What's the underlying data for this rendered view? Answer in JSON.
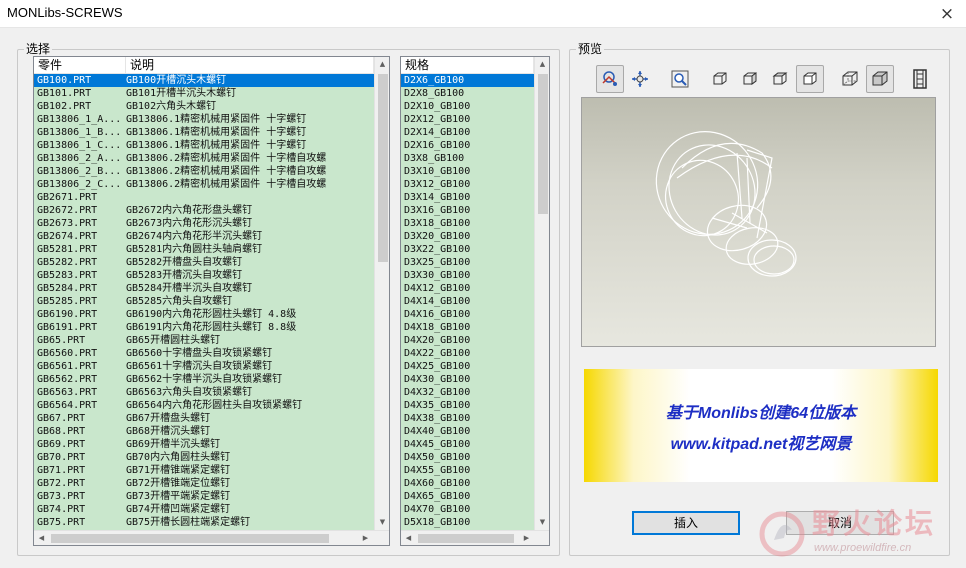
{
  "window": {
    "title": "MONLibs-SCREWS",
    "close_icon": "×"
  },
  "select_group": {
    "label": "选择",
    "columns": {
      "part": "零件",
      "desc": "说明"
    },
    "rows": [
      {
        "part": "GB100.PRT",
        "desc": "GB100开槽沉头木螺钉",
        "selected": true
      },
      {
        "part": "GB101.PRT",
        "desc": "GB101开槽半沉头木螺钉"
      },
      {
        "part": "GB102.PRT",
        "desc": "GB102六角头木螺钉"
      },
      {
        "part": "GB13806_1_A...",
        "desc": "GB13806.1精密机械用紧固件     十字螺钉"
      },
      {
        "part": "GB13806_1_B...",
        "desc": "GB13806.1精密机械用紧固件     十字螺钉"
      },
      {
        "part": "GB13806_1_C...",
        "desc": "GB13806.1精密机械用紧固件     十字螺钉"
      },
      {
        "part": "GB13806_2_A...",
        "desc": "GB13806.2精密机械用紧固件    十字槽自攻螺"
      },
      {
        "part": "GB13806_2_B...",
        "desc": "GB13806.2精密机械用紧固件    十字槽自攻螺"
      },
      {
        "part": "GB13806_2_C...",
        "desc": "GB13806.2精密机械用紧固件    十字槽自攻螺"
      },
      {
        "part": "GB2671.PRT",
        "desc": ""
      },
      {
        "part": "GB2672.PRT",
        "desc": "GB2672内六角花形盘头螺钉"
      },
      {
        "part": "GB2673.PRT",
        "desc": "GB2673内六角花形沉头螺钉"
      },
      {
        "part": "GB2674.PRT",
        "desc": "GB2674内六角花形半沉头螺钉"
      },
      {
        "part": "GB5281.PRT",
        "desc": "GB5281内六角圆柱头轴肩螺钉"
      },
      {
        "part": "GB5282.PRT",
        "desc": "GB5282开槽盘头自攻螺钉"
      },
      {
        "part": "GB5283.PRT",
        "desc": "GB5283开槽沉头自攻螺钉"
      },
      {
        "part": "GB5284.PRT",
        "desc": "GB5284开槽半沉头自攻螺钉"
      },
      {
        "part": "GB5285.PRT",
        "desc": "GB5285六角头自攻螺钉"
      },
      {
        "part": "GB6190.PRT",
        "desc": "GB6190内六角花形圆柱头螺钉   4.8级"
      },
      {
        "part": "GB6191.PRT",
        "desc": "GB6191内六角花形圆柱头螺钉   8.8级"
      },
      {
        "part": "GB65.PRT",
        "desc": "GB65开槽圆柱头螺钉"
      },
      {
        "part": "GB6560.PRT",
        "desc": "GB6560十字槽盘头自攻锁紧螺钉"
      },
      {
        "part": "GB6561.PRT",
        "desc": "GB6561十字槽沉头自攻锁紧螺钉"
      },
      {
        "part": "GB6562.PRT",
        "desc": "GB6562十字槽半沉头自攻锁紧螺钉"
      },
      {
        "part": "GB6563.PRT",
        "desc": "GB6563六角头自攻锁紧螺钉"
      },
      {
        "part": "GB6564.PRT",
        "desc": "GB6564内六角花形圆柱头自攻锁紧螺钉"
      },
      {
        "part": "GB67.PRT",
        "desc": "GB67开槽盘头螺钉"
      },
      {
        "part": "GB68.PRT",
        "desc": "GB68开槽沉头螺钉"
      },
      {
        "part": "GB69.PRT",
        "desc": "GB69开槽半沉头螺钉"
      },
      {
        "part": "GB70.PRT",
        "desc": "GB70内六角圆柱头螺钉"
      },
      {
        "part": "GB71.PRT",
        "desc": "GB71开槽锥端紧定螺钉"
      },
      {
        "part": "GB72.PRT",
        "desc": "GB72开槽锥端定位螺钉"
      },
      {
        "part": "GB73.PRT",
        "desc": "GB73开槽平端紧定螺钉"
      },
      {
        "part": "GB74.PRT",
        "desc": "GB74开槽凹端紧定螺钉"
      },
      {
        "part": "GB75.PRT",
        "desc": "GB75开槽长圆柱端紧定螺钉"
      }
    ]
  },
  "spec_list": {
    "column": "规格",
    "rows": [
      {
        "spec": "D2X6_GB100",
        "selected": true
      },
      {
        "spec": "D2X8_GB100"
      },
      {
        "spec": "D2X10_GB100"
      },
      {
        "spec": "D2X12_GB100"
      },
      {
        "spec": "D2X14_GB100"
      },
      {
        "spec": "D2X16_GB100"
      },
      {
        "spec": "D3X8_GB100"
      },
      {
        "spec": "D3X10_GB100"
      },
      {
        "spec": "D3X12_GB100"
      },
      {
        "spec": "D3X14_GB100"
      },
      {
        "spec": "D3X16_GB100"
      },
      {
        "spec": "D3X18_GB100"
      },
      {
        "spec": "D3X20_GB100"
      },
      {
        "spec": "D3X22_GB100"
      },
      {
        "spec": "D3X25_GB100"
      },
      {
        "spec": "D3X30_GB100"
      },
      {
        "spec": "D4X12_GB100"
      },
      {
        "spec": "D4X14_GB100"
      },
      {
        "spec": "D4X16_GB100"
      },
      {
        "spec": "D4X18_GB100"
      },
      {
        "spec": "D4X20_GB100"
      },
      {
        "spec": "D4X22_GB100"
      },
      {
        "spec": "D4X25_GB100"
      },
      {
        "spec": "D4X30_GB100"
      },
      {
        "spec": "D4X32_GB100"
      },
      {
        "spec": "D4X35_GB100"
      },
      {
        "spec": "D4X38_GB100"
      },
      {
        "spec": "D4X40_GB100"
      },
      {
        "spec": "D4X45_GB100"
      },
      {
        "spec": "D4X50_GB100"
      },
      {
        "spec": "D4X55_GB100"
      },
      {
        "spec": "D4X60_GB100"
      },
      {
        "spec": "D4X65_GB100"
      },
      {
        "spec": "D4X70_GB100"
      },
      {
        "spec": "D5X18_GB100"
      }
    ]
  },
  "preview_group": {
    "label": "预览",
    "toolbar": [
      {
        "icon": "spin-rotate-icon",
        "pressed": true
      },
      {
        "icon": "pan-icon",
        "pressed": false
      },
      {
        "icon": "zoom-window-icon",
        "pressed": false
      },
      {
        "icon": "view-front-icon",
        "pressed": false
      },
      {
        "icon": "view-side-icon",
        "pressed": false
      },
      {
        "icon": "view-top-icon",
        "pressed": false
      },
      {
        "icon": "view-iso-icon",
        "pressed": true
      },
      {
        "icon": "wireframe-icon",
        "pressed": false
      },
      {
        "icon": "shaded-icon",
        "pressed": true
      },
      {
        "icon": "film-strip-icon",
        "pressed": false
      }
    ]
  },
  "banner": {
    "line1": "基于Monlibs创建64位版本",
    "line2": "www.kitpad.net视艺网景",
    "colors": {
      "text": "#1d2ec4",
      "edge": "#f6d800"
    }
  },
  "buttons": {
    "insert": "插入",
    "cancel": "取消"
  },
  "watermark": {
    "text": "野火论坛",
    "url": "www.proewildfire.cn"
  }
}
